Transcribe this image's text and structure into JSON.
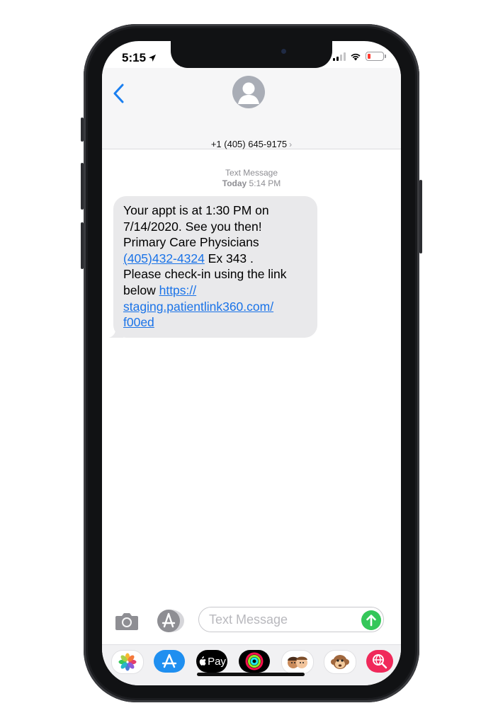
{
  "status_bar": {
    "time": "5:15"
  },
  "header": {
    "contact": "+1 (405) 645-9175",
    "chevron": "›"
  },
  "meta": {
    "service": "Text Message",
    "day": "Today",
    "time": "5:14 PM"
  },
  "message": {
    "line1": "Your appt is at 1:30 PM on",
    "line2": "7/14/2020. See you then!",
    "line3": "Primary Care Physicians",
    "phone_link": "(405)432-4324",
    "ext": " Ex 343 .",
    "line5": "Please check-in using the link",
    "line6_prefix": "below ",
    "url_part1": "https://",
    "url_part2": "staging.patientlink360.com/",
    "url_part3": "f00ed"
  },
  "composer": {
    "placeholder": "Text Message"
  },
  "apps": {
    "applepay_label": "Pay"
  },
  "colors": {
    "link": "#1a73e8",
    "send": "#34c759",
    "bubble": "#e9e9eb"
  }
}
